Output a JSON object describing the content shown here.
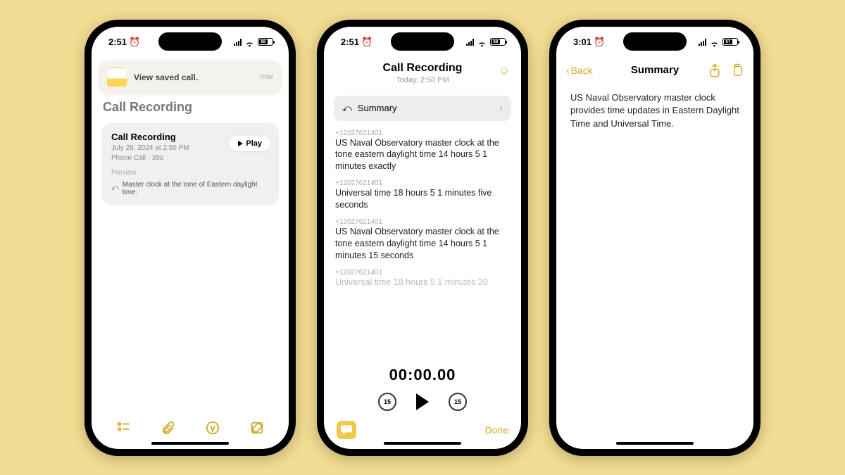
{
  "phone1": {
    "status_time": "2:51",
    "battery": "68",
    "notification": {
      "title": "View saved call.",
      "time": "now"
    },
    "header_title": "Call Recording",
    "card": {
      "title": "Call Recording",
      "date": "July 29, 2024 at 2:50 PM",
      "sub": "Phone Call · 39s",
      "play": "Play",
      "preview_label": "Preview",
      "preview_text": "Master clock at the tone of Eastern daylight time."
    }
  },
  "phone2": {
    "status_time": "2:51",
    "battery": "68",
    "title": "Call Recording",
    "subtitle": "Today, 2:50 PM",
    "summary_label": "Summary",
    "timer": "00:00.00",
    "skip_back": "15",
    "skip_fwd": "15",
    "done": "Done",
    "transcript": [
      {
        "num": "+12027621401",
        "txt": "US Naval Observatory master clock at the tone eastern daylight time 14 hours 5 1 minutes exactly"
      },
      {
        "num": "+12027621401",
        "txt": "Universal time 18 hours 5 1 minutes five seconds"
      },
      {
        "num": "+12027621401",
        "txt": "US Naval Observatory master clock at the tone eastern daylight time 14 hours 5 1 minutes 15 seconds"
      },
      {
        "num": "+12027621401",
        "txt": "Universal time 18 hours 5 1 minutes 20"
      }
    ]
  },
  "phone3": {
    "status_time": "3:01",
    "battery": "67",
    "back": "Back",
    "title": "Summary",
    "body": "US Naval Observatory master clock provides time updates in Eastern Daylight Time and Universal Time."
  }
}
